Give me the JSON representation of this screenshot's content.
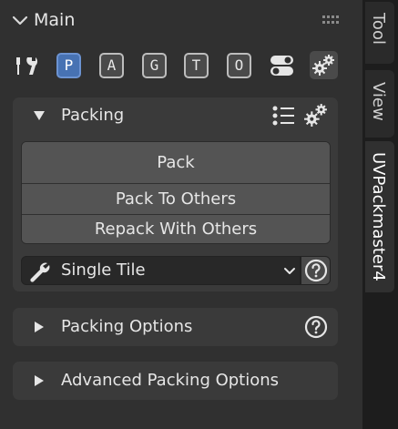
{
  "main": {
    "title": "Main",
    "tabs": [
      "P",
      "A",
      "G",
      "T",
      "O"
    ],
    "active_tab": "P"
  },
  "packing": {
    "title": "Packing",
    "buttons": [
      "Pack",
      "Pack To Others",
      "Repack With Others"
    ],
    "tile_mode": "Single Tile"
  },
  "sections": {
    "packing_options": "Packing Options",
    "advanced_packing_options": "Advanced Packing Options"
  },
  "sidebar_tabs": [
    "Tool",
    "View",
    "UVPackmaster4"
  ],
  "colors": {
    "panel_bg": "#303030",
    "subpanel_bg": "#3a3a3a",
    "button_bg": "#545454",
    "active_blue": "#4772b3"
  }
}
